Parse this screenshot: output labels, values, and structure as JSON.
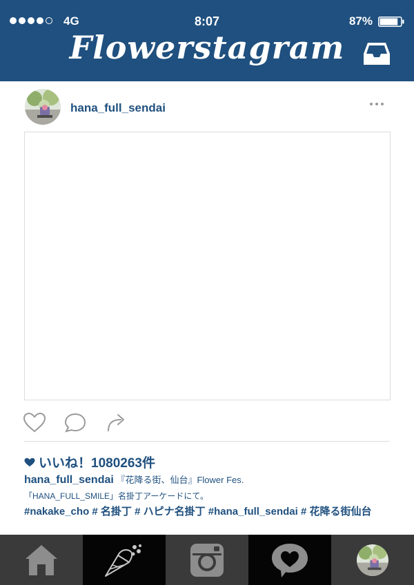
{
  "status_bar": {
    "signal_bars_filled": 4,
    "signal_bars_total": 5,
    "network": "4G",
    "time": "8:07",
    "battery": "87%",
    "battery_level": 0.87
  },
  "header": {
    "app_title": "Flowerstagram",
    "inbox_icon": "inbox-tray-icon"
  },
  "post": {
    "username": "hana_full_sendai",
    "more_icon": "more-dots-icon",
    "actions": {
      "like_icon": "heart-outline-icon",
      "comment_icon": "speech-bubble-icon",
      "share_icon": "share-arrow-icon"
    },
    "likes_text": "いいね！1080263件",
    "caption_user": "hana_full_sendai",
    "caption_line1": "『花降る街、仙台』Flower Fes.",
    "caption_line2": "「HANA_FULL_SMILE」名掛丁アーケードにて。",
    "hashtags": "#nakake_cho # 名掛丁 # ハピナ名掛丁 #hana_full_sendai # 花降る街仙台"
  },
  "tab_bar": {
    "tabs": [
      {
        "icon": "home-icon"
      },
      {
        "icon": "flower-bouquet-icon"
      },
      {
        "icon": "camera-icon"
      },
      {
        "icon": "heart-bubble-icon"
      },
      {
        "icon": "profile-avatar-icon"
      }
    ]
  },
  "colors": {
    "brand": "#1f507f",
    "tab_dark": "#3a3a3a",
    "tab_black": "#050505"
  }
}
